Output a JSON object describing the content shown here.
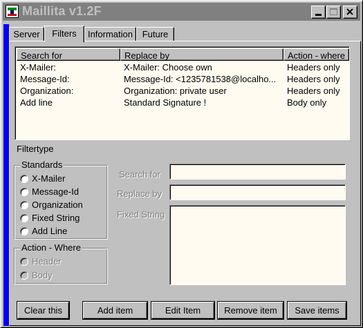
{
  "window": {
    "title": "Maillita v1.2F",
    "icon": "app-icon"
  },
  "tabs": [
    {
      "label": "Server",
      "active": false
    },
    {
      "label": "Filters",
      "active": true
    },
    {
      "label": "Information",
      "active": false
    },
    {
      "label": "Future",
      "active": false
    }
  ],
  "filter_list": {
    "columns": [
      "Search for",
      "Replace by",
      "Action - where"
    ],
    "rows": [
      [
        "X-Mailer:",
        "X-Mailer: Choose own",
        "Headers only"
      ],
      [
        "Message-Id:",
        "Message-Id: <1235781538@localho...",
        "Headers only"
      ],
      [
        "Organization:",
        "Organization: private user",
        "Headers only"
      ],
      [
        "Add line",
        "Standard Signature !",
        "Body only"
      ]
    ]
  },
  "filtertype_label": "Filtertype",
  "standards": {
    "caption": "Standards",
    "options": [
      "X-Mailer",
      "Message-Id",
      "Organization",
      "Fixed String",
      "Add Line"
    ]
  },
  "action_where": {
    "caption": "Action - Where",
    "options": [
      "Header",
      "Body"
    ]
  },
  "fields": {
    "search_for_label": "Search for",
    "search_for_value": "",
    "replace_by_label": "Replace by",
    "replace_by_value": "",
    "fixed_string_label": "Fixed String",
    "fixed_string_value": ""
  },
  "buttons": {
    "clear": "Clear this",
    "add": "Add item",
    "edit": "Edit Item",
    "remove": "Remove item",
    "save": "Save items"
  },
  "colors": {
    "face": "#c0c0c0",
    "sidebar": "#0000ff",
    "field_bg": "#fffbf0",
    "titlebar": "#808080"
  }
}
